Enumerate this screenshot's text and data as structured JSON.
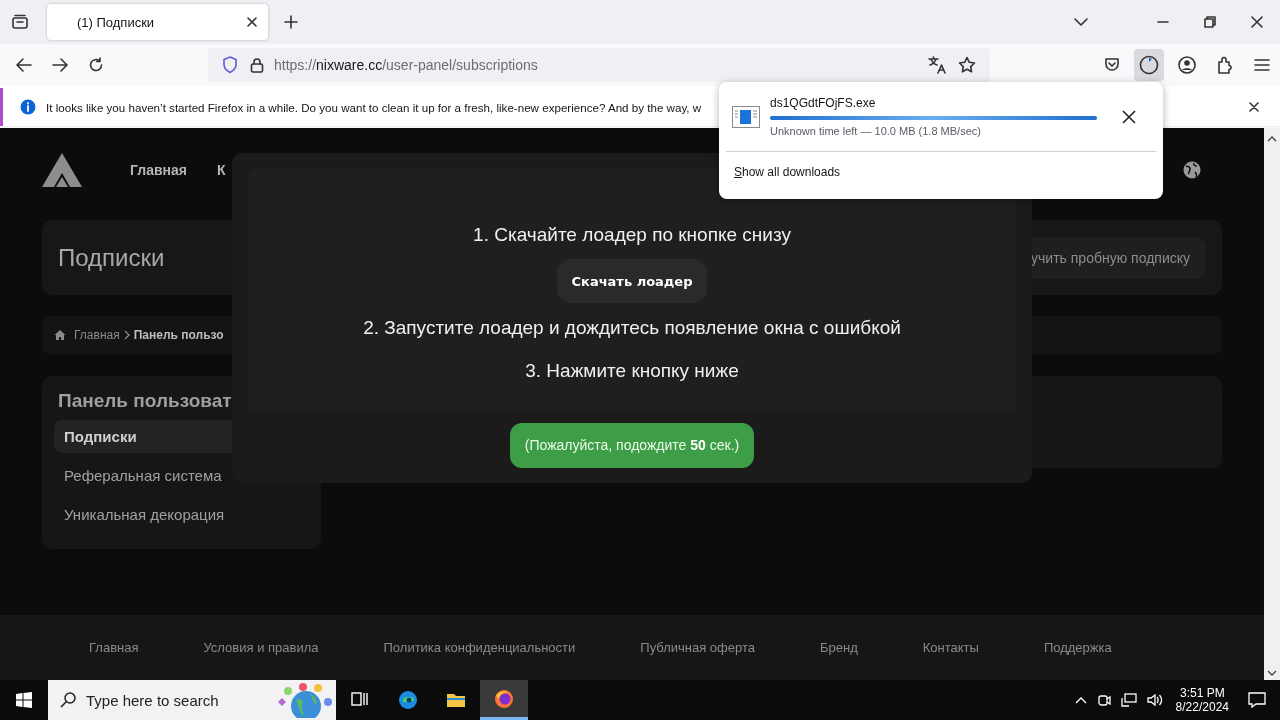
{
  "browser": {
    "tabs": [
      {
        "title": "(1) Подписки",
        "selected": true
      }
    ],
    "url": {
      "scheme": "https://",
      "host": "nixware.cc",
      "path": "/user-panel/subscriptions"
    },
    "notification": {
      "text": "It looks like you haven’t started Firefox in a while. Do you want to clean it up for a fresh, like-new experience? And by the way, w"
    },
    "downloads_panel": {
      "items": [
        {
          "filename": "ds1QGdtFOjFS.exe",
          "level": 1,
          "status": "Unknown time left — 10.0 MB (1.8 MB/sec)"
        }
      ],
      "show_all": "Show all downloads"
    }
  },
  "site": {
    "nav": [
      "Главная",
      "К"
    ],
    "page_title": "Подписки",
    "trial_button": "учить пробную подписку",
    "breadcrumbs": [
      "Главная",
      "Панель пользо"
    ],
    "sidebar": {
      "title": "Панель пользоват",
      "items": [
        {
          "label": "Подписки",
          "selected": true
        },
        {
          "label": "Реферальная система",
          "selected": false
        },
        {
          "label": "Уникальная декорация",
          "selected": false
        }
      ]
    },
    "footer_links": [
      "Главная",
      "Условия и правила",
      "Политика конфиденциальности",
      "Публичная оферта",
      "Бренд",
      "Контакты",
      "Поддержка"
    ]
  },
  "modal": {
    "items": [
      {
        "kind": "step",
        "text": "1. Скачайте лоадер по кнопке снизу"
      },
      {
        "kind": "button",
        "text": "Скачать лоадер"
      },
      {
        "kind": "step",
        "text": "2. Запустите лоадер и дождитесь появление окна с ошибкой"
      },
      {
        "kind": "step",
        "text": "3. Нажмите кнопку ниже"
      }
    ],
    "wait_button": "(Пожалуйста, подождите **50** сек.)"
  },
  "taskbar": {
    "search_placeholder": "Type here to search",
    "apps": [
      {
        "kind": "taskview",
        "selected": false
      },
      {
        "kind": "edge",
        "selected": false
      },
      {
        "kind": "explorer",
        "selected": false
      },
      {
        "kind": "firefox",
        "selected": true
      }
    ],
    "time": "3:51 PM",
    "date": "8/22/2024"
  }
}
